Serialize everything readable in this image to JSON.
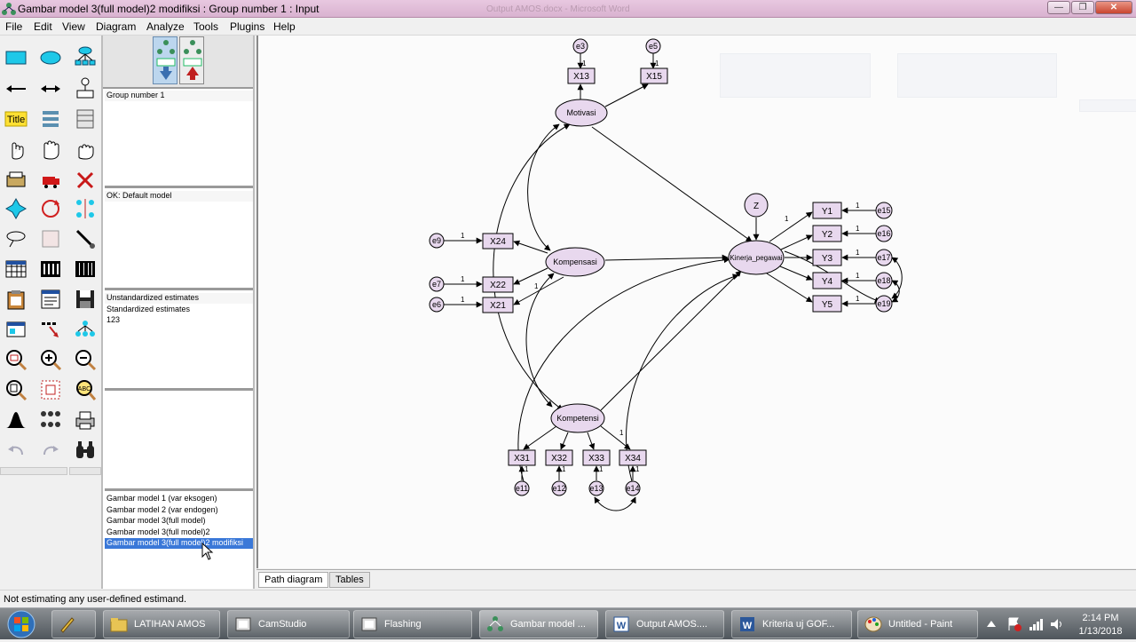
{
  "window": {
    "title": "Gambar model 3(full model)2 modifiksi : Group number 1 : Input",
    "ghost_title": "Output AMOS.docx - Microsoft Word",
    "buttons": {
      "minimize": "—",
      "restore": "❐",
      "close": "✕"
    }
  },
  "menu": [
    {
      "label": "File"
    },
    {
      "label": "Edit"
    },
    {
      "label": "View"
    },
    {
      "label": "Diagram"
    },
    {
      "label": "Analyze"
    },
    {
      "label": "Tools"
    },
    {
      "label": "Plugins"
    },
    {
      "label": "Help"
    }
  ],
  "toolbox": {
    "title_tool_label": "Title",
    "tools": [
      "draw-observed-icon",
      "draw-unobserved-icon",
      "draw-latent-indicator-icon",
      "single-arrow-icon",
      "double-arrow-icon",
      "unique-variable-icon",
      "title-icon",
      "list-variables-model-icon",
      "list-variables-dataset-icon",
      "select-one-icon",
      "select-all-icon",
      "deselect-all-icon",
      "duplicate-icon",
      "move-icon",
      "erase-icon",
      "change-shape-icon",
      "rotate-icon",
      "reflect-icon",
      "move-parameter-icon",
      "scroll-icon",
      "touch-up-icon",
      "data-files-icon",
      "analysis-properties-icon",
      "calculate-estimates-icon",
      "copy-clipboard-icon",
      "text-output-icon",
      "save-icon",
      "object-properties-icon",
      "drag-properties-icon",
      "preserve-symmetries-icon",
      "zoom-area-icon",
      "zoom-in-icon",
      "zoom-out-icon",
      "view-page-icon",
      "fit-page-icon",
      "loupe-icon",
      "bayesian-icon",
      "multiple-group-icon",
      "print-icon",
      "undo-icon",
      "redo-icon",
      "specification-search-icon"
    ]
  },
  "panels": {
    "groups": [
      "Group number 1"
    ],
    "models": [
      "OK: Default model"
    ],
    "estimates": [
      "Unstandardized estimates",
      "Standardized estimates",
      "123"
    ],
    "files": [
      {
        "label": "Gambar model 1 (var eksogen)",
        "selected": false
      },
      {
        "label": "Gambar model 2 (var endogen)",
        "selected": false
      },
      {
        "label": "Gambar model 3(full model)",
        "selected": false
      },
      {
        "label": "Gambar model 3(full model)2",
        "selected": false
      },
      {
        "label": "Gambar model 3(full model)2 modifiksi",
        "selected": true
      }
    ]
  },
  "diagram": {
    "latent": [
      {
        "id": "motivasi",
        "label": "Motivasi"
      },
      {
        "id": "kompensasi",
        "label": "Kompensasi"
      },
      {
        "id": "kompetensi",
        "label": "Kompetensi"
      },
      {
        "id": "kinerja",
        "label": "Kinerja_pegawai"
      }
    ],
    "observed": [
      "X13",
      "X15",
      "X24",
      "X22",
      "X21",
      "X31",
      "X32",
      "X33",
      "X34",
      "Y1",
      "Y2",
      "Y3",
      "Y4",
      "Y5"
    ],
    "errors": [
      "e3",
      "e5",
      "e9",
      "e7",
      "e6",
      "e11",
      "e12",
      "e13",
      "e14",
      "e15",
      "e16",
      "e17",
      "e18",
      "e19"
    ],
    "disturbance": "Z",
    "path_label": "1"
  },
  "tabs": [
    {
      "label": "Path diagram",
      "active": true
    },
    {
      "label": "Tables",
      "active": false
    }
  ],
  "status": "Not estimating any user-defined estimand.",
  "taskbar": {
    "tasks": [
      {
        "label": "",
        "icon": "tool-icon"
      },
      {
        "label": "LATIHAN AMOS",
        "icon": "folder-icon"
      },
      {
        "label": "CamStudio",
        "icon": "camstudio-icon"
      },
      {
        "label": "Flashing",
        "icon": "camstudio-icon"
      },
      {
        "label": "Gambar model ...",
        "icon": "amos-icon"
      },
      {
        "label": "Output AMOS....",
        "icon": "word-icon"
      },
      {
        "label": "Kriteria uj GOF...",
        "icon": "word-icon"
      },
      {
        "label": "Untitled - Paint",
        "icon": "paint-icon"
      }
    ],
    "time": "2:14 PM",
    "date": "1/13/2018"
  },
  "colors": {
    "titlebar": "#d9b2d0",
    "node_fill": "#e8d8ee",
    "selection": "#3a78d8",
    "taskbar": "#4f565c"
  }
}
